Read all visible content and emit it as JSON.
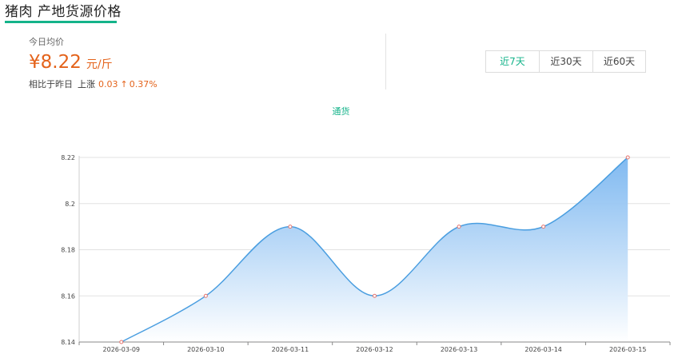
{
  "header": {
    "title": "猪肉 产地货源价格"
  },
  "summary": {
    "today_label": "今日均价",
    "price": "¥8.22",
    "unit": "元/斤",
    "compare_label": "相比于昨日",
    "trend": "上涨",
    "delta": "0.03",
    "arrow": "↑",
    "percent": "0.37%"
  },
  "range_tabs": [
    {
      "label": "近7天",
      "active": true
    },
    {
      "label": "近30天",
      "active": false
    },
    {
      "label": "近60天",
      "active": false
    }
  ],
  "colors": {
    "accent": "#14b38a",
    "price": "#e4631b",
    "line": "#4a9ee0",
    "area_top": "#7ab6f0",
    "area_bottom": "#ffffff"
  },
  "chart_data": {
    "type": "area",
    "x": [
      "2026-03-09",
      "2026-03-10",
      "2026-03-11",
      "2026-03-12",
      "2026-03-13",
      "2026-03-14",
      "2026-03-15"
    ],
    "series": [
      {
        "name": "通货",
        "values": [
          8.14,
          8.16,
          8.19,
          8.16,
          8.19,
          8.19,
          8.22
        ]
      }
    ],
    "yticks": [
      "8.14",
      "8.16",
      "8.18",
      "8.2",
      "8.22"
    ],
    "ylim": [
      8.14,
      8.22
    ],
    "grid": true,
    "legend_position": "top-center",
    "smooth": true
  }
}
